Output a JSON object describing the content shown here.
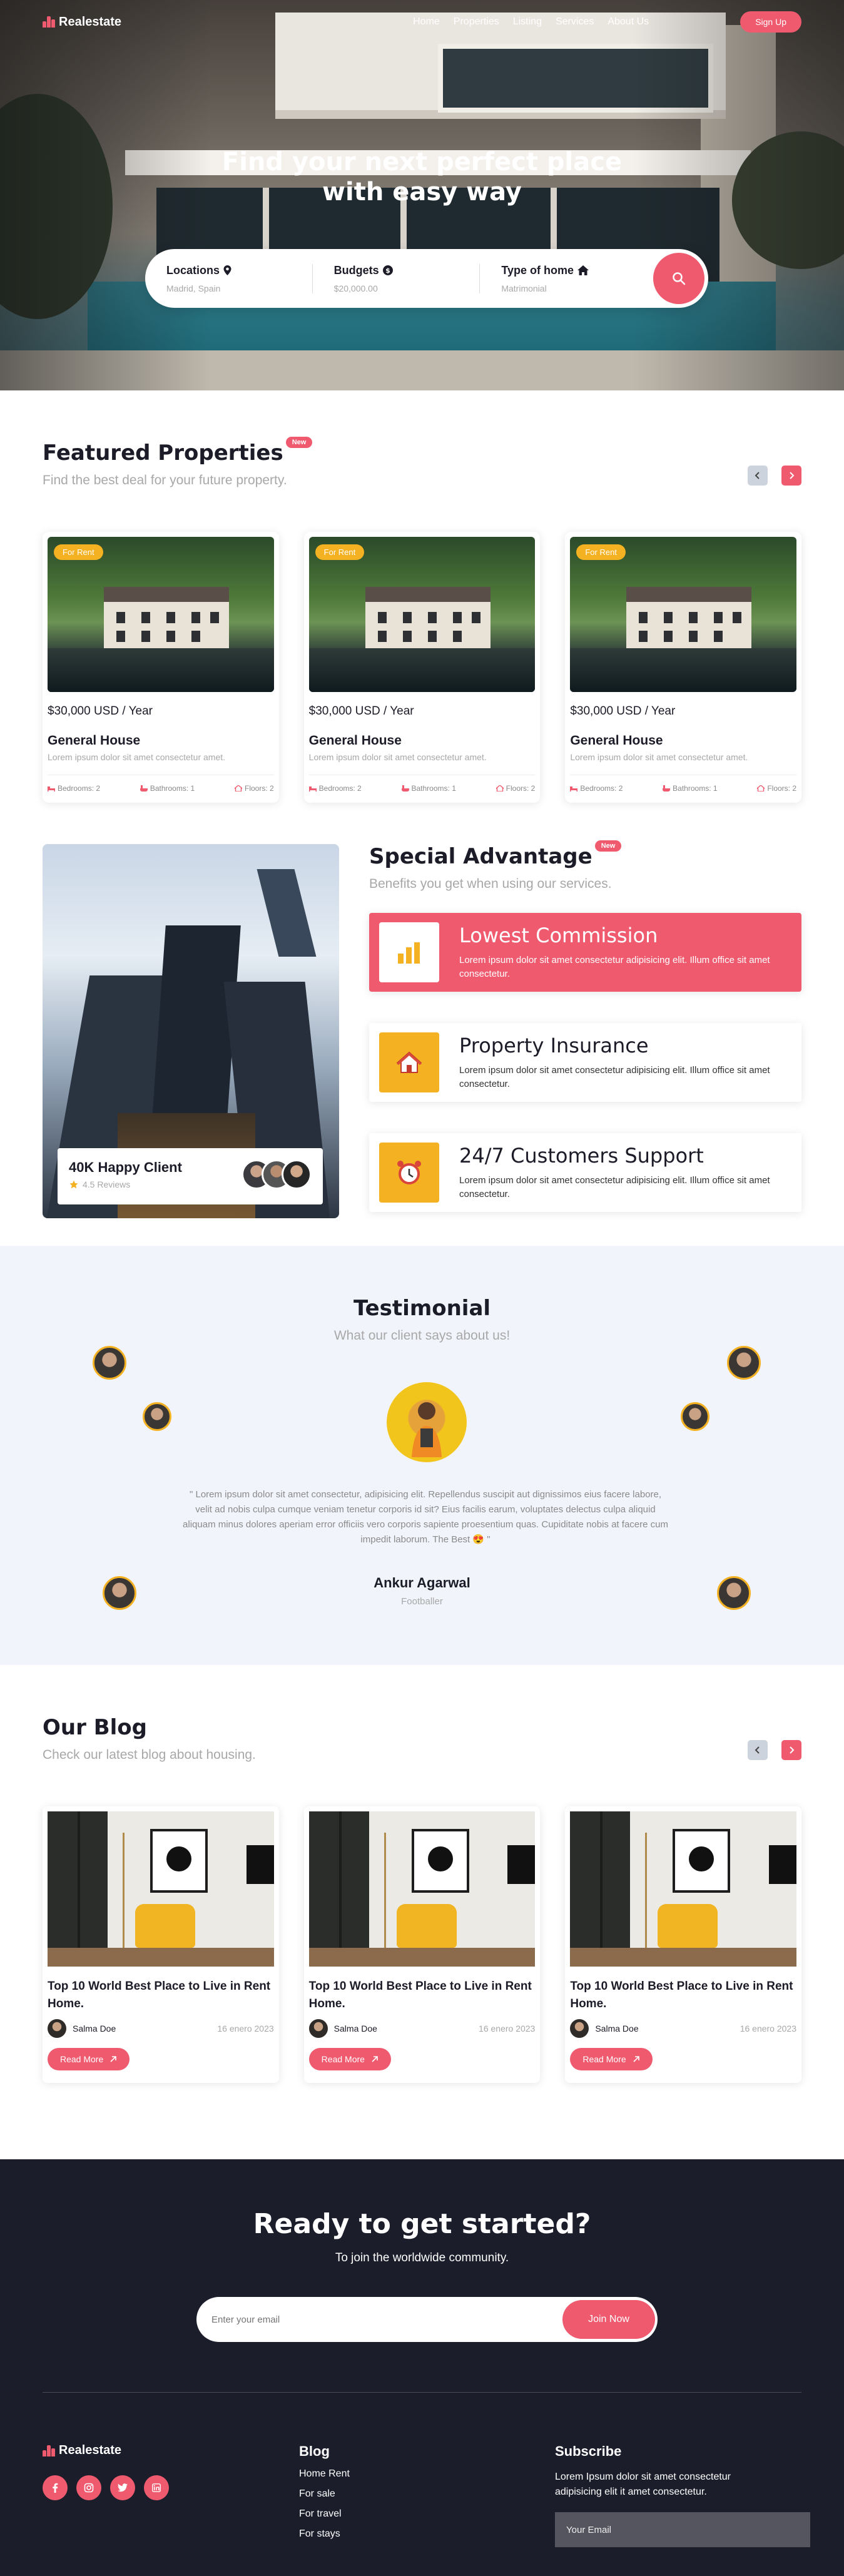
{
  "brand": {
    "name": "Realestate",
    "accent": "#ef5a6f",
    "yellow": "#f4b121",
    "dark": "#1c1d2b"
  },
  "nav": {
    "links": [
      "Home",
      "Properties",
      "Listing",
      "Services",
      "About Us"
    ],
    "signup_label": "Sign Up"
  },
  "hero": {
    "title_line1": "Find your next perfect place",
    "title_line2": "with easy way",
    "search": [
      {
        "label": "Locations",
        "icon": "map-pin-icon",
        "value": "Madrid, Spain"
      },
      {
        "label": "Budgets",
        "icon": "dollar-icon",
        "value": "$20,000.00"
      },
      {
        "label": "Type of home",
        "icon": "home-icon",
        "value": "Matrimonial"
      }
    ]
  },
  "featured": {
    "title": "Featured Properties",
    "badge": "New",
    "subtitle": "Find the best deal for your future property.",
    "cards": [
      {
        "tag": "For Rent",
        "price": "$30,000 USD / Year",
        "title": "General House",
        "desc": "Lorem ipsum dolor sit amet consectetur amet.",
        "bedrooms": "Bedrooms: 2",
        "bathrooms": "Bathrooms: 1",
        "floors": "Floors: 2"
      },
      {
        "tag": "For Rent",
        "price": "$30,000 USD / Year",
        "title": "General House",
        "desc": "Lorem ipsum dolor sit amet consectetur amet.",
        "bedrooms": "Bedrooms: 2",
        "bathrooms": "Bathrooms: 1",
        "floors": "Floors: 2"
      },
      {
        "tag": "For Rent",
        "price": "$30,000 USD / Year",
        "title": "General House",
        "desc": "Lorem ipsum dolor sit amet consectetur amet.",
        "bedrooms": "Bedrooms: 2",
        "bathrooms": "Bathrooms: 1",
        "floors": "Floors: 2"
      }
    ]
  },
  "special": {
    "title": "Special Advantage",
    "badge": "New",
    "subtitle": "Benefits you get when using our services.",
    "happy_title": "40K Happy Client",
    "happy_reviews": "4.5 Reviews",
    "features": [
      {
        "title": "Lowest Commission",
        "desc": "Lorem ipsum dolor sit amet consectetur adipisicing elit. Illum office sit amet consectetur.",
        "icon": "bar-chart-icon"
      },
      {
        "title": "Property Insurance",
        "desc": "Lorem ipsum dolor sit amet consectetur adipisicing elit. Illum office sit amet consectetur.",
        "icon": "house-icon"
      },
      {
        "title": "24/7 Customers Support",
        "desc": "Lorem ipsum dolor sit amet consectetur adipisicing elit. Illum office sit amet consectetur.",
        "icon": "alarm-clock-icon"
      }
    ]
  },
  "testimonial": {
    "title": "Testimonial",
    "subtitle": "What our client says about us!",
    "quote": "\" Lorem ipsum dolor sit amet consectetur, adipisicing elit. Repellendus suscipit aut dignissimos eius facere labore, velit ad nobis culpa cumque veniam tenetur corporis id sit? Eius facilis earum, voluptates delectus culpa aliquid aliquam minus dolores aperiam error officiis vero corporis sapiente proesentium quas. Cupiditate nobis at facere cum impedit laborum. The Best 😍 \"",
    "name": "Ankur Agarwal",
    "role": "Footballer"
  },
  "blog": {
    "title": "Our Blog",
    "subtitle": "Check our latest blog about housing.",
    "read_more": "Read More",
    "posts": [
      {
        "title": "Top 10 World Best Place to Live in Rent Home.",
        "author": "Salma Doe",
        "date": "16 enero 2023"
      },
      {
        "title": "Top 10 World Best Place to Live in Rent Home.",
        "author": "Salma Doe",
        "date": "16 enero 2023"
      },
      {
        "title": "Top 10 World Best Place to Live in Rent Home.",
        "author": "Salma Doe",
        "date": "16 enero 2023"
      }
    ]
  },
  "cta": {
    "title": "Ready to get started?",
    "subtitle": "To join the worldwide community.",
    "placeholder": "Enter your email",
    "button": "Join Now"
  },
  "footer": {
    "brand": "Realestate",
    "social": [
      "facebook-icon",
      "instagram-icon",
      "twitter-icon",
      "linkedin-icon"
    ],
    "blog_head": "Blog",
    "blog_links": [
      "Home Rent",
      "For sale",
      "For travel",
      "For stays"
    ],
    "subscribe_head": "Subscribe",
    "subscribe_text": "Lorem Ipsum dolor sit amet consectetur adipisicing elit it amet consectetur.",
    "email_placeholder": "Your Email"
  }
}
